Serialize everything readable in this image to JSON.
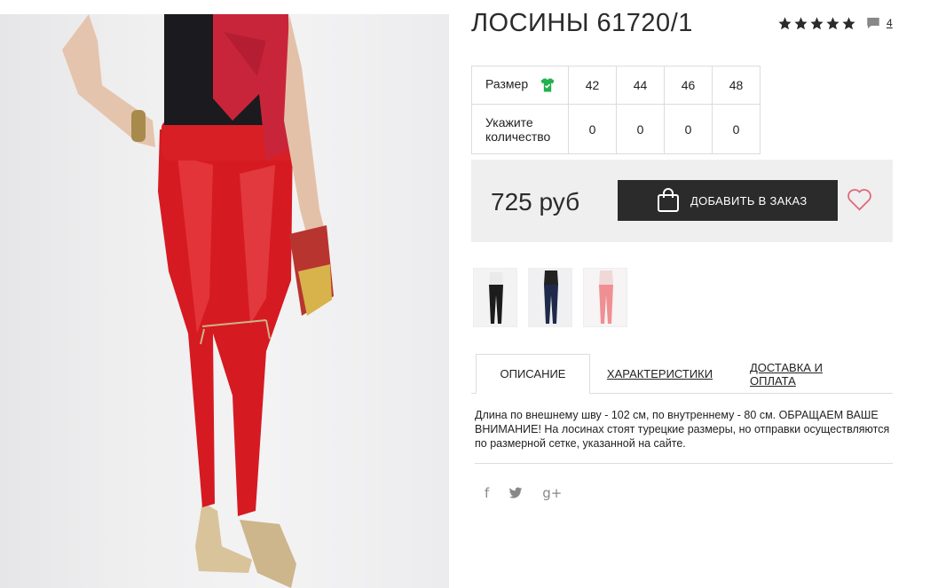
{
  "product": {
    "title": "ЛОСИНЫ 61720/1",
    "rating_stars": 5,
    "review_count": "4",
    "price": "725 руб",
    "order_button_label": "ДОБАВИТЬ В ЗАКАЗ"
  },
  "size_table": {
    "size_label": "Размер",
    "qty_label": "Укажите количество",
    "sizes": [
      "42",
      "44",
      "46",
      "48"
    ],
    "quantities": [
      "0",
      "0",
      "0",
      "0"
    ]
  },
  "tabs": [
    {
      "label": "ОПИСАНИЕ"
    },
    {
      "label": "ХАРАКТЕРИСТИКИ"
    },
    {
      "label": "ДОСТАВКА И ОПЛАТА"
    }
  ],
  "description": "Длина по внешнему шву - 102 см, по внутреннему - 80 см. ОБРАЩАЕМ ВАШЕ ВНИМАНИЕ! На лосинах стоят турецкие размеры, но отправки осуществляются по размерной сетке, указанной на сайте.",
  "social": [
    {
      "icon": "facebook-icon",
      "glyph": "f"
    },
    {
      "icon": "twitter-icon",
      "glyph": "🐦"
    },
    {
      "icon": "google-plus-icon",
      "glyph": "g+"
    }
  ],
  "colors": {
    "accent_dark": "#2b2b2b",
    "heart": "#e06a7a",
    "shirt_icon": "#22b14c",
    "star": "#2b2b2b"
  },
  "icons": {
    "shirt": "shirt-size-icon",
    "comment": "comment-icon",
    "bag": "shopping-bag-icon",
    "heart": "heart-icon"
  }
}
